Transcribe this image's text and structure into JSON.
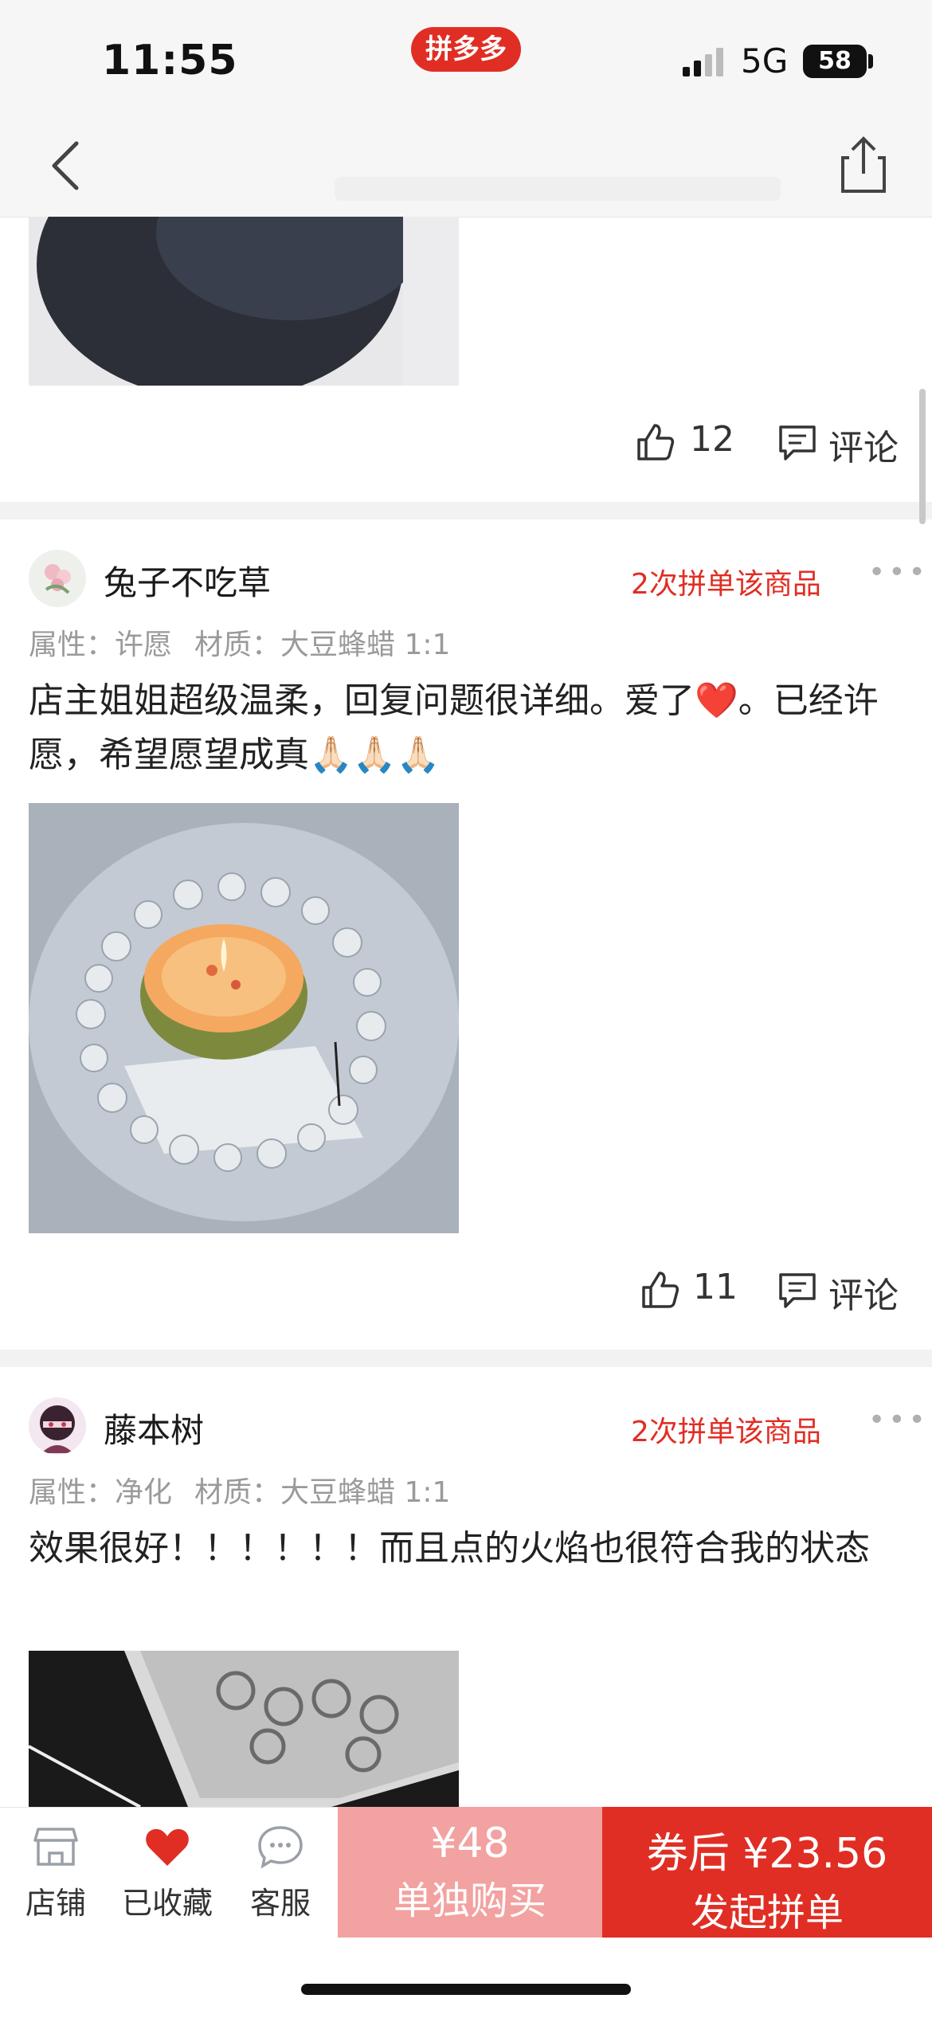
{
  "status": {
    "time": "11:55",
    "app_badge": "拼多多",
    "network": "5G",
    "battery": "58"
  },
  "reviews": [
    {
      "likes": "12",
      "comment_label": "评论"
    },
    {
      "username": "兔子不吃草",
      "order_tag": "2次拼单该商品",
      "attr1": "属性：许愿",
      "attr2": "材质：大豆蜂蜡 1:1",
      "text": "店主姐姐超级温柔，回复问题很详细。爱了❤️。已经许愿，希望愿望成真🙏🏻🙏🏻🙏🏻",
      "likes": "11",
      "comment_label": "评论"
    },
    {
      "username": "藤本树",
      "order_tag": "2次拼单该商品",
      "attr1": "属性：净化",
      "attr2": "材质：大豆蜂蜡 1:1",
      "text": "效果很好！！！！！！而且点的火焰也很符合我的状态"
    }
  ],
  "bottom": {
    "tabs": [
      "店铺",
      "已收藏",
      "客服"
    ],
    "solo_price": "¥48",
    "solo_label": "单独购买",
    "group_price": "券后 ¥23.56",
    "group_label": "发起拼单"
  },
  "colors": {
    "brand_red": "#e02e24",
    "solo_pink": "#f2a2a0",
    "divider": "#f2f2f2"
  }
}
